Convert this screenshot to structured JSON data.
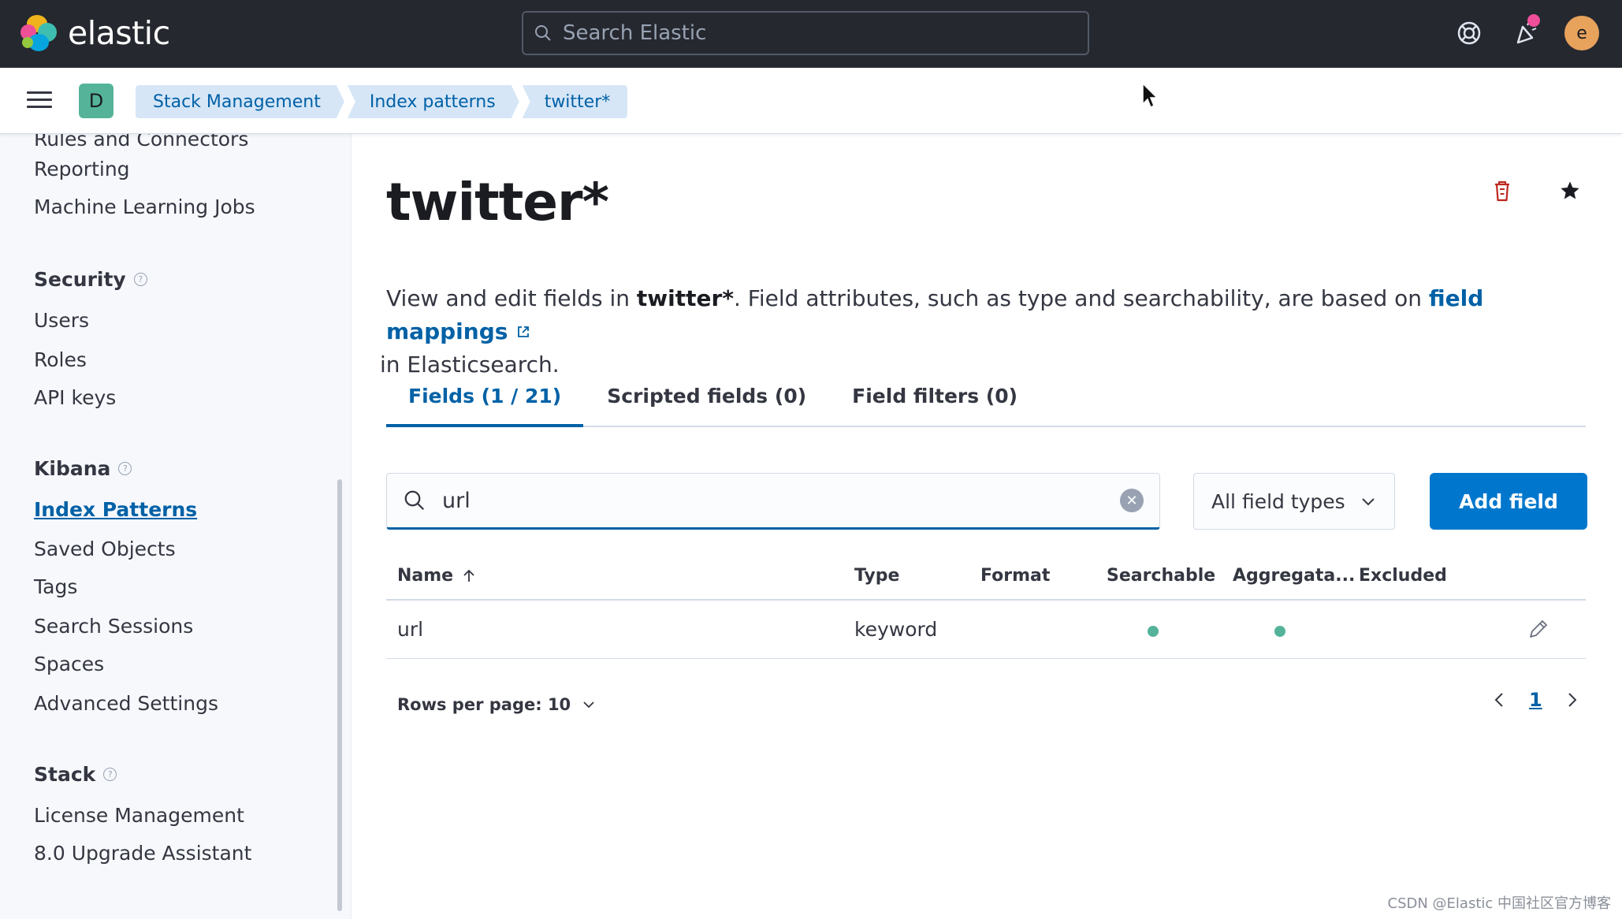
{
  "header": {
    "logo_text": "elastic",
    "search_placeholder": "Search Elastic",
    "avatar_initial": "e",
    "icons": [
      "help-icon",
      "newsfeed-icon"
    ],
    "news_dot_color": "#f04e98"
  },
  "breadcrumb_bar": {
    "space_initial": "D",
    "crumbs": [
      "Stack Management",
      "Index patterns",
      "twitter*"
    ]
  },
  "sidebar": {
    "cut_item": "Rules and Connectors",
    "items_top": [
      "Reporting",
      "Machine Learning Jobs"
    ],
    "sections": [
      {
        "title": "Security",
        "items": [
          "Users",
          "Roles",
          "API keys"
        ]
      },
      {
        "title": "Kibana",
        "items": [
          "Index Patterns",
          "Saved Objects",
          "Tags",
          "Search Sessions",
          "Spaces",
          "Advanced Settings"
        ],
        "active": "Index Patterns"
      },
      {
        "title": "Stack",
        "items": [
          "License Management",
          "8.0 Upgrade Assistant"
        ]
      }
    ]
  },
  "main": {
    "title": "twitter*",
    "description": {
      "prefix": "View and edit fields in ",
      "pattern": "twitter*",
      "middle": ". Field attributes, such as type and searchability, are based on ",
      "link": "field mappings",
      "suffix": " in Elasticsearch."
    },
    "tabs": [
      "Fields (1 / 21)",
      "Scripted fields (0)",
      "Field filters (0)"
    ],
    "active_tab": "Fields (1 / 21)",
    "filter": {
      "value": "url"
    },
    "type_select": "All field types",
    "add_button": "Add field",
    "table": {
      "columns": [
        "Name",
        "Type",
        "Format",
        "Searchable",
        "Aggregata...",
        "Excluded"
      ],
      "rows": [
        {
          "name": "url",
          "type": "keyword",
          "format": "",
          "searchable": true,
          "aggregatable": true,
          "excluded": false
        }
      ]
    },
    "rows_per_page": "Rows per page: 10",
    "current_page": "1"
  },
  "watermark": "CSDN @Elastic 中国社区官方博客",
  "colors": {
    "header_bg": "#25282f",
    "accent": "#0077cc",
    "link": "#0061a6",
    "success_dot": "#54b399",
    "danger": "#bd271e"
  }
}
